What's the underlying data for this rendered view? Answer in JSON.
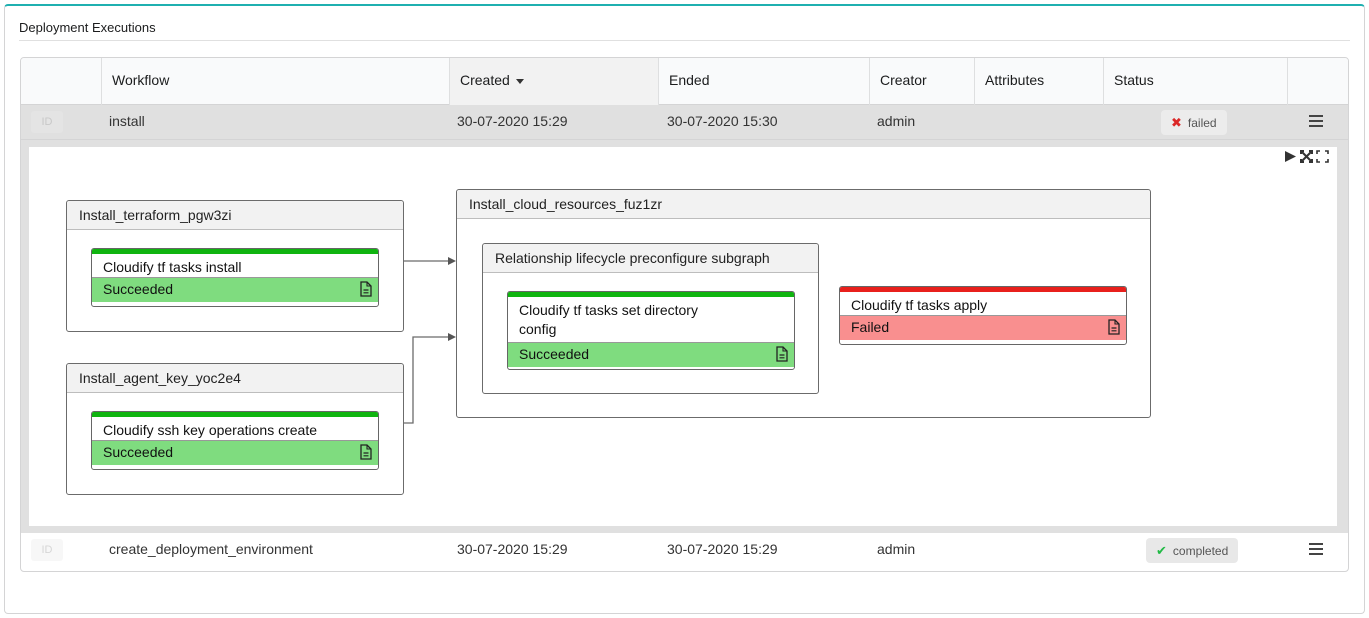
{
  "widget": {
    "title": "Deployment Executions",
    "accent_color": "#1fb0b0"
  },
  "table": {
    "columns": [
      {
        "key": "id",
        "label": ""
      },
      {
        "key": "workflow",
        "label": "Workflow"
      },
      {
        "key": "created",
        "label": "Created",
        "sorted": "desc"
      },
      {
        "key": "ended",
        "label": "Ended"
      },
      {
        "key": "creator",
        "label": "Creator"
      },
      {
        "key": "attributes",
        "label": "Attributes"
      },
      {
        "key": "status",
        "label": "Status"
      },
      {
        "key": "actions",
        "label": ""
      }
    ],
    "rows": [
      {
        "id": "ID",
        "workflow": "install",
        "created": "30-07-2020 15:29",
        "ended": "30-07-2020 15:30",
        "creator": "admin",
        "attributes": "",
        "status": "failed",
        "status_icon": "x-icon",
        "expanded": true
      },
      {
        "id": "ID",
        "workflow": "create_deployment_environment",
        "created": "30-07-2020 15:29",
        "ended": "30-07-2020 15:29",
        "creator": "admin",
        "attributes": "",
        "status": "completed",
        "status_icon": "check-icon",
        "expanded": false
      }
    ]
  },
  "graph": {
    "tools": [
      "play-icon",
      "fit-icon",
      "fullscreen-icon"
    ],
    "groups": [
      {
        "title": "Install_terraform_pgw3zi"
      },
      {
        "title": "Install_agent_key_yoc2e4"
      },
      {
        "title": "Install_cloud_resources_fuz1zr"
      },
      {
        "title": "Relationship lifecycle preconfigure subgraph"
      }
    ],
    "tasks": [
      {
        "name": "Cloudify tf tasks install",
        "state": "Succeeded",
        "color": "#7fdc7f"
      },
      {
        "name": "Cloudify ssh key operations create",
        "state": "Succeeded",
        "color": "#7fdc7f"
      },
      {
        "name": "Cloudify tf tasks set directory config",
        "state": "Succeeded",
        "color": "#7fdc7f"
      },
      {
        "name": "Cloudify tf tasks apply",
        "state": "Failed",
        "color": "#f98f8f"
      }
    ]
  }
}
